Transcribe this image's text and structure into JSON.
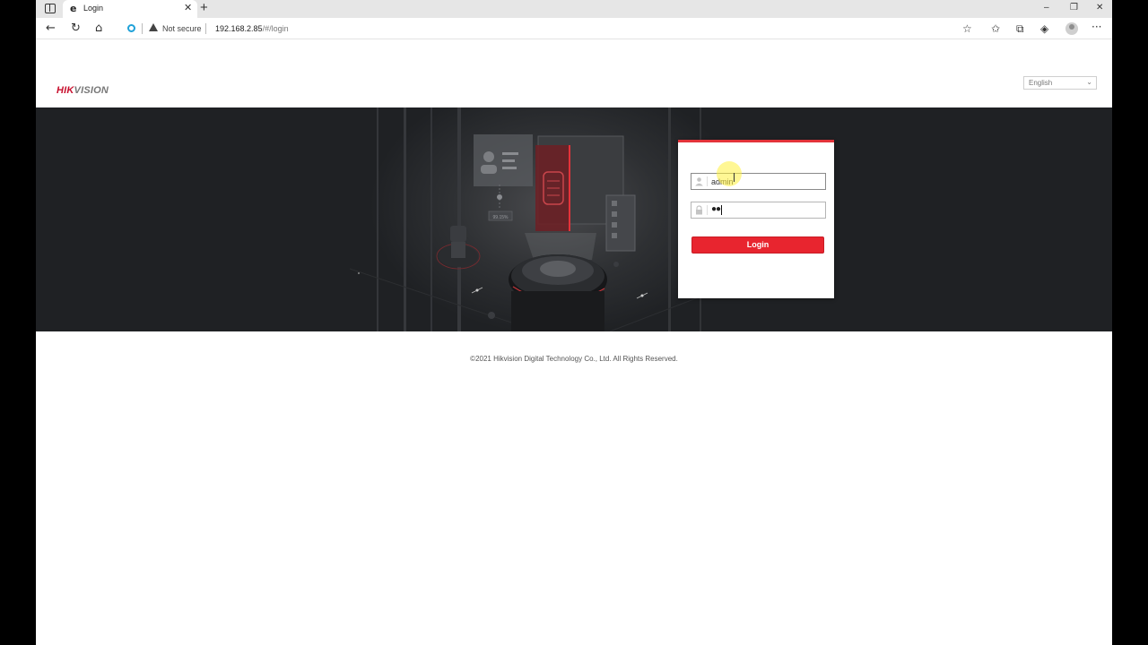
{
  "browser": {
    "tab": {
      "title": "Login",
      "close": "✕"
    },
    "new_tab": "+",
    "window_controls": {
      "minimize": "–",
      "restore": "❐",
      "close": "✕"
    },
    "nav": {
      "back": "←",
      "refresh": "↻",
      "home": "⌂"
    },
    "address": {
      "security_label": "Not secure",
      "host": "192.168.2.85",
      "path": "/#/login"
    },
    "toolbar_icons": [
      "add-favorite-icon",
      "favorites-icon",
      "collections-icon",
      "browser-essentials-icon",
      "profile-icon",
      "more-menu-icon"
    ],
    "more": "···"
  },
  "header": {
    "logo_hik": "HIK",
    "logo_vision": "VISION",
    "language": {
      "selected": "English",
      "chevron": "⌄"
    }
  },
  "banner": {
    "percent_label": "99.15%"
  },
  "login": {
    "username_value": "admin",
    "password_dots": "●●",
    "button_label": "Login",
    "accent": "#e8252f"
  },
  "footer": {
    "copyright": "©2021 Hikvision Digital Technology Co., Ltd. All Rights Reserved."
  }
}
